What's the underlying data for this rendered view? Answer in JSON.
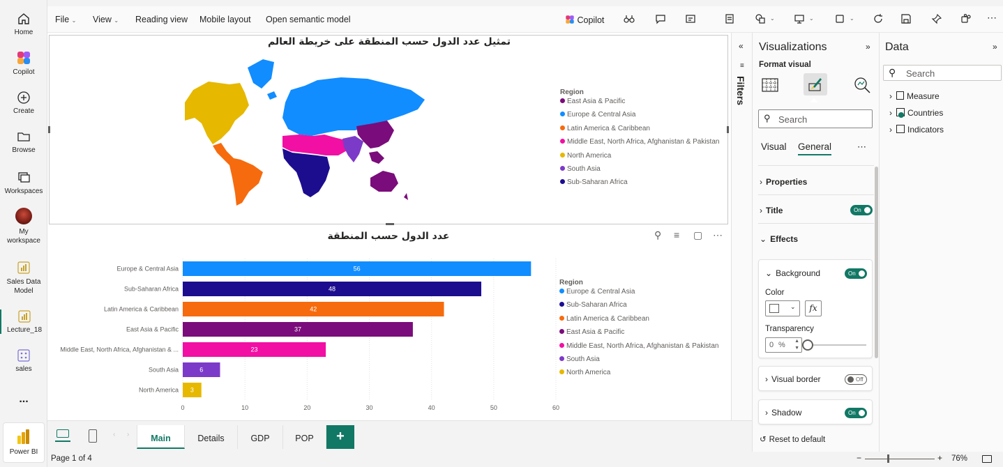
{
  "app": {
    "name": "Power BI"
  },
  "left_nav": [
    {
      "label": "Home",
      "icon": "home-icon"
    },
    {
      "label": "Copilot",
      "icon": "copilot-icon"
    },
    {
      "label": "Create",
      "icon": "create-icon"
    },
    {
      "label": "Browse",
      "icon": "browse-icon"
    },
    {
      "label": "Workspaces",
      "icon": "workspaces-icon"
    },
    {
      "label": "My workspace",
      "icon": "avatar"
    },
    {
      "label": "Sales Data Model",
      "icon": "report-icon"
    },
    {
      "label": "Lecture_18",
      "icon": "report-icon"
    },
    {
      "label": "sales",
      "icon": "dataset-icon"
    },
    {
      "label": "...",
      "icon": "more-icon"
    }
  ],
  "menu": {
    "file": "File",
    "view": "View",
    "reading": "Reading view",
    "mobile": "Mobile layout",
    "semantic": "Open semantic model",
    "copilot": "Copilot"
  },
  "map_visual": {
    "title": "تمثيل عدد الدول حسب المنطقة على خريطة العالم",
    "legend_title": "Region",
    "legend": [
      {
        "label": "East Asia & Pacific",
        "color": "#7b0c7b"
      },
      {
        "label": "Europe & Central Asia",
        "color": "#118dff"
      },
      {
        "label": "Latin America & Caribbean",
        "color": "#f66b0e"
      },
      {
        "label": "Middle East, North Africa, Afghanistan & Pakistan",
        "color": "#f20fa4"
      },
      {
        "label": "North America",
        "color": "#e6b800"
      },
      {
        "label": "South Asia",
        "color": "#7c3ac9"
      },
      {
        "label": "Sub-Saharan Africa",
        "color": "#1c0d8f"
      }
    ]
  },
  "bar_visual": {
    "legend_title": "Region",
    "legend": [
      {
        "label": "Europe & Central Asia",
        "color": "#118dff"
      },
      {
        "label": "Sub-Saharan Africa",
        "color": "#1c0d8f"
      },
      {
        "label": "Latin America & Caribbean",
        "color": "#f66b0e"
      },
      {
        "label": "East Asia & Pacific",
        "color": "#7b0c7b"
      },
      {
        "label": "Middle East, North Africa, Afghanistan & Pakistan",
        "color": "#f20fa4"
      },
      {
        "label": "South Asia",
        "color": "#7c3ac9"
      },
      {
        "label": "North America",
        "color": "#e6b800"
      }
    ]
  },
  "chart_data": {
    "type": "bar",
    "orientation": "horizontal",
    "title": "عدد الدول حسب المنطقة",
    "categories": [
      "Europe & Central Asia",
      "Sub-Saharan Africa",
      "Latin America & Caribbean",
      "East Asia & Pacific",
      "Middle East, North Africa, Afghanistan & ...",
      "South Asia",
      "North America"
    ],
    "values": [
      56,
      48,
      42,
      37,
      23,
      6,
      3
    ],
    "colors": [
      "#118dff",
      "#1c0d8f",
      "#f66b0e",
      "#7b0c7b",
      "#f20fa4",
      "#7c3ac9",
      "#e6b800"
    ],
    "xlim": [
      0,
      60
    ],
    "xticks": [
      0,
      10,
      20,
      30,
      40,
      50,
      60
    ],
    "grid": "vertical"
  },
  "filters": {
    "label": "Filters"
  },
  "viz_pane": {
    "title": "Visualizations",
    "format_label": "Format visual",
    "search_placeholder": "Search",
    "tab_visual": "Visual",
    "tab_general": "General",
    "properties": "Properties",
    "title_section": "Title",
    "title_toggle": "On",
    "effects": "Effects",
    "background": "Background",
    "background_toggle": "On",
    "color_label": "Color",
    "fx": "fx",
    "transparency_label": "Transparency",
    "transparency_value": "0",
    "transparency_unit": "%",
    "visual_border": "Visual border",
    "visual_border_toggle": "Off",
    "shadow": "Shadow",
    "shadow_toggle": "On",
    "reset": "Reset to default"
  },
  "data_pane": {
    "title": "Data",
    "search_placeholder": "Search",
    "tables": [
      "Measure",
      "Countries",
      "Indicators"
    ]
  },
  "tabs": [
    "Main",
    "Details",
    "GDP",
    "POP"
  ],
  "status": {
    "page": "Page 1 of 4",
    "zoom": "76%"
  }
}
